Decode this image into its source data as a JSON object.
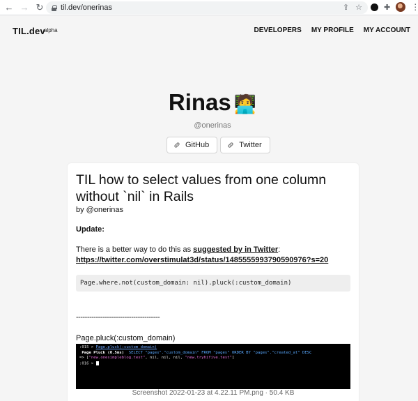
{
  "browser": {
    "url": "til.dev/onerinas",
    "back_icon": "arrow-left",
    "forward_icon": "arrow-right",
    "reload_icon": "reload"
  },
  "site": {
    "brand": "TIL.dev",
    "brand_tag": "alpha",
    "nav": [
      "DEVELOPERS",
      "MY PROFILE",
      "MY ACCOUNT"
    ]
  },
  "profile": {
    "name": "Rinas",
    "emoji": "🧑‍💻",
    "handle": "@onerinas",
    "links": [
      {
        "label": "GitHub",
        "icon": "link-icon"
      },
      {
        "label": "Twitter",
        "icon": "link-icon"
      }
    ]
  },
  "post": {
    "title": "TIL how to select values from one column without `nil` in Rails",
    "byline": "by @onerinas",
    "update_label": "Update:",
    "para_text": "There is a better way to do this as ",
    "para_link": "suggested by in Twitter",
    "para_colon": ":",
    "para_url": "https://twitter.com/overstimulat3d/status/1485555993790590976?s=20",
    "code": "Page.where.not(custom_domain: nil).pluck(:custom_domain)",
    "divider": "--------------------------------------",
    "pluck_label": "Page.pluck(:custom_domain)",
    "terminal": {
      "line1_prompt": ":015 > ",
      "line1_method": "Page.pluck(:custom_domain)",
      "line2_label": " Page Pluck (0.5ms)  ",
      "line2_sql": "SELECT \"pages\".\"custom_domain\" FROM \"pages\" ORDER BY \"pages\".\"created_at\" DESC",
      "line3_prefix": "=> [",
      "line3_str1": "\"new.onesimpleblog.test\"",
      "line3_mid": ", nil, nil, nil, ",
      "line3_str2": "\"new.tryhifive.test\"",
      "line3_suffix": "]",
      "line4_prompt": ":016 > "
    },
    "caption": "Screenshot 2022-01-23 at 4.22.11 PM.png · 50.4 KB"
  }
}
